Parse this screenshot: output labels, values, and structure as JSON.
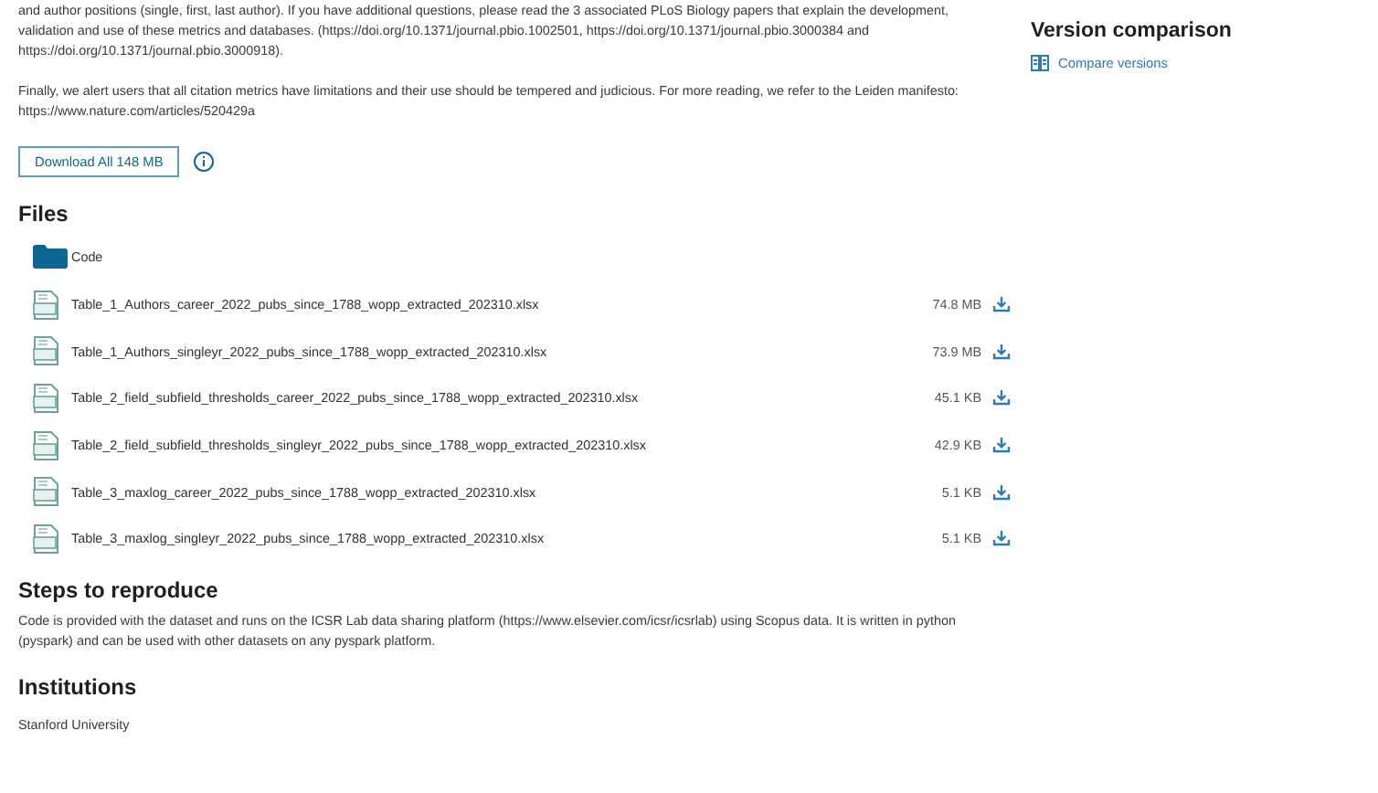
{
  "description": {
    "paragraphs": [
      "and author positions (single, first, last author). If you have additional questions, please read the 3 associated PLoS Biology papers that explain the development, validation and use of these metrics and databases. (https://doi.org/10.1371/journal.pbio.1002501, https://doi.org/10.1371/journal.pbio.3000384 and https://doi.org/10.1371/journal.pbio.3000918).",
      "Finally, we alert users that all citation metrics have limitations and their use should be tempered and judicious. For more reading, we refer to the Leiden manifesto: https://www.nature.com/articles/520429a"
    ]
  },
  "download_all": {
    "label": "Download All 148 MB"
  },
  "files": {
    "title": "Files",
    "items": [
      {
        "kind": "folder",
        "name": "Code"
      },
      {
        "kind": "file",
        "name": "Table_1_Authors_career_2022_pubs_since_1788_wopp_extracted_202310.xlsx",
        "size": "74.8 MB"
      },
      {
        "kind": "file",
        "name": "Table_1_Authors_singleyr_2022_pubs_since_1788_wopp_extracted_202310.xlsx",
        "size": "73.9 MB"
      },
      {
        "kind": "file",
        "name": "Table_2_field_subfield_thresholds_career_2022_pubs_since_1788_wopp_extracted_202310.xlsx",
        "size": "45.1 KB"
      },
      {
        "kind": "file",
        "name": "Table_2_field_subfield_thresholds_singleyr_2022_pubs_since_1788_wopp_extracted_202310.xlsx",
        "size": "42.9 KB"
      },
      {
        "kind": "file",
        "name": "Table_3_maxlog_career_2022_pubs_since_1788_wopp_extracted_202310.xlsx",
        "size": "5.1 KB"
      },
      {
        "kind": "file",
        "name": "Table_3_maxlog_singleyr_2022_pubs_since_1788_wopp_extracted_202310.xlsx",
        "size": "5.1 KB"
      }
    ]
  },
  "steps": {
    "title": "Steps to reproduce",
    "text": "Code is provided with the dataset and runs on the ICSR Lab data sharing platform (https://www.elsevier.com/icsr/icsrlab) using Scopus data. It is written in python (pyspark) and can be used with other datasets on any pyspark platform."
  },
  "institutions": {
    "title": "Institutions",
    "items": [
      "Stanford University"
    ]
  },
  "sidebar": {
    "title": "Version comparison",
    "link": "Compare versions"
  }
}
